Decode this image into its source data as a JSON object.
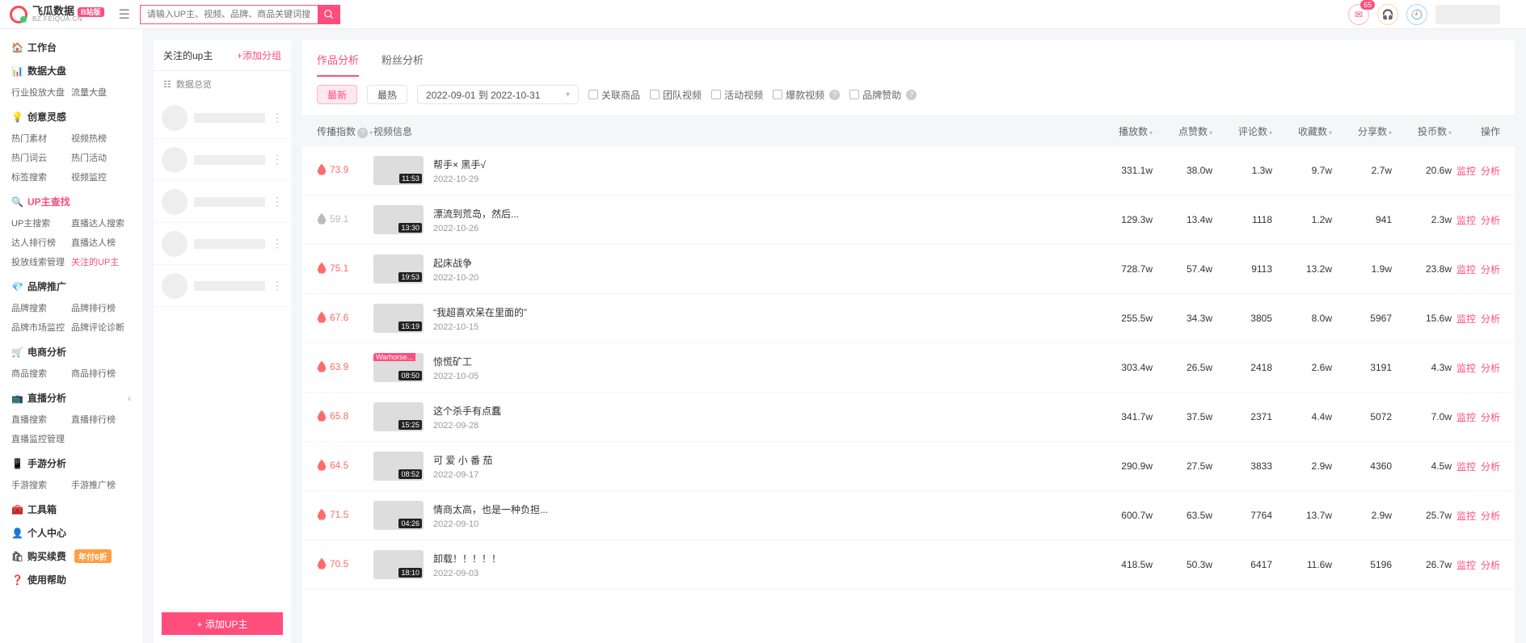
{
  "brand": {
    "name": "飞瓜数据",
    "sub": "BZ.FEIQUA.CN",
    "badge": "B站版"
  },
  "search": {
    "placeholder": "请输入UP主、视频、品牌、商品关键词搜索"
  },
  "notif": {
    "count": "65"
  },
  "sidebar": {
    "sections": [
      {
        "icon": "🏠",
        "title": "工作台",
        "links": []
      },
      {
        "icon": "📊",
        "title": "数据大盘",
        "links": [
          {
            "t": "行业投放大盘"
          },
          {
            "t": "流量大盘"
          }
        ]
      },
      {
        "icon": "💡",
        "title": "创意灵感",
        "links": [
          {
            "t": "热门素材"
          },
          {
            "t": "视频热榜"
          },
          {
            "t": "热门词云"
          },
          {
            "t": "热门活动"
          },
          {
            "t": "标签搜索"
          },
          {
            "t": "视频监控"
          }
        ]
      },
      {
        "icon": "🔍",
        "title": "UP主查找",
        "accent": true,
        "links": [
          {
            "t": "UP主搜索"
          },
          {
            "t": "直播达人搜索"
          },
          {
            "t": "达人排行榜"
          },
          {
            "t": "直播达人榜"
          },
          {
            "t": "投放线索管理"
          },
          {
            "t": "关注的UP主",
            "active": true
          }
        ]
      },
      {
        "icon": "💎",
        "title": "品牌推广",
        "links": [
          {
            "t": "品牌搜索"
          },
          {
            "t": "品牌排行榜"
          },
          {
            "t": "品牌市场监控"
          },
          {
            "t": "品牌评论诊断"
          }
        ]
      },
      {
        "icon": "🛒",
        "title": "电商分析",
        "links": [
          {
            "t": "商品搜索"
          },
          {
            "t": "商品排行榜"
          }
        ]
      },
      {
        "icon": "📺",
        "title": "直播分析",
        "arrow": true,
        "links": [
          {
            "t": "直播搜索"
          },
          {
            "t": "直播排行榜"
          },
          {
            "t": "直播监控管理"
          }
        ]
      },
      {
        "icon": "📱",
        "title": "手游分析",
        "links": [
          {
            "t": "手游搜索"
          },
          {
            "t": "手游推广榜"
          }
        ]
      },
      {
        "icon": "🧰",
        "title": "工具箱",
        "links": []
      },
      {
        "icon": "👤",
        "title": "个人中心",
        "links": []
      },
      {
        "icon": "🛍",
        "title": "购买续费",
        "discount": "年付6折",
        "links": []
      },
      {
        "icon": "❓",
        "title": "使用帮助",
        "links": []
      }
    ]
  },
  "leftPanel": {
    "title": "关注的up主",
    "addGroup": "+添加分组",
    "summary": "数据总览",
    "addUp": "+ 添加UP主",
    "rows": 5
  },
  "tabs": [
    {
      "t": "作品分析",
      "active": true
    },
    {
      "t": "粉丝分析"
    }
  ],
  "filters": {
    "sort": [
      {
        "t": "最新",
        "active": true
      },
      {
        "t": "最热"
      }
    ],
    "dateRange": "2022-09-01 到 2022-10-31",
    "checks": [
      {
        "t": "关联商品"
      },
      {
        "t": "团队视频"
      },
      {
        "t": "活动视频"
      },
      {
        "t": "爆款视频",
        "q": true
      },
      {
        "t": "品牌赞助",
        "q": true
      }
    ]
  },
  "columns": {
    "index": "传播指数",
    "video": "视频信息",
    "nums": [
      "播放数",
      "点赞数",
      "评论数",
      "收藏数",
      "分享数",
      "投币数"
    ],
    "op": "操作"
  },
  "opLabels": {
    "m": "监控",
    "a": "分析"
  },
  "rows": [
    {
      "idx": "73.9",
      "hot": true,
      "dur": "11:53",
      "title": "帮手× 黑手√",
      "date": "2022-10-29",
      "n": [
        "331.1w",
        "38.0w",
        "1.3w",
        "9.7w",
        "2.7w",
        "20.6w"
      ]
    },
    {
      "idx": "59.1",
      "hot": false,
      "dur": "13:30",
      "title": "漂流到荒岛，然后...",
      "date": "2022-10-26",
      "n": [
        "129.3w",
        "13.4w",
        "1118",
        "1.2w",
        "941",
        "2.3w"
      ]
    },
    {
      "idx": "75.1",
      "hot": true,
      "dur": "19:53",
      "title": "起床战争",
      "date": "2022-10-20",
      "n": [
        "728.7w",
        "57.4w",
        "9113",
        "13.2w",
        "1.9w",
        "23.8w"
      ]
    },
    {
      "idx": "67.6",
      "hot": true,
      "dur": "15:19",
      "title": "“我超喜欢呆在里面的”",
      "date": "2022-10-15",
      "n": [
        "255.5w",
        "34.3w",
        "3805",
        "8.0w",
        "5967",
        "15.6w"
      ]
    },
    {
      "idx": "63.9",
      "hot": true,
      "dur": "08:50",
      "title": "惊慌矿工",
      "date": "2022-10-05",
      "tag": "Warhorse...",
      "n": [
        "303.4w",
        "26.5w",
        "2418",
        "2.6w",
        "3191",
        "4.3w"
      ]
    },
    {
      "idx": "65.8",
      "hot": true,
      "dur": "15:25",
      "title": "这个杀手有点蠢",
      "date": "2022-09-28",
      "n": [
        "341.7w",
        "37.5w",
        "2371",
        "4.4w",
        "5072",
        "7.0w"
      ]
    },
    {
      "idx": "64.5",
      "hot": true,
      "dur": "08:52",
      "title": "可 爱 小 番 茄",
      "date": "2022-09-17",
      "n": [
        "290.9w",
        "27.5w",
        "3833",
        "2.9w",
        "4360",
        "4.5w"
      ]
    },
    {
      "idx": "71.5",
      "hot": true,
      "dur": "04:26",
      "title": "情商太高，也是一种负担...",
      "date": "2022-09-10",
      "n": [
        "600.7w",
        "63.5w",
        "7764",
        "13.7w",
        "2.9w",
        "25.7w"
      ]
    },
    {
      "idx": "70.5",
      "hot": true,
      "dur": "18:10",
      "title": "卸载！！！！！",
      "date": "2022-09-03",
      "n": [
        "418.5w",
        "50.3w",
        "6417",
        "11.6w",
        "5196",
        "26.7w"
      ]
    }
  ]
}
